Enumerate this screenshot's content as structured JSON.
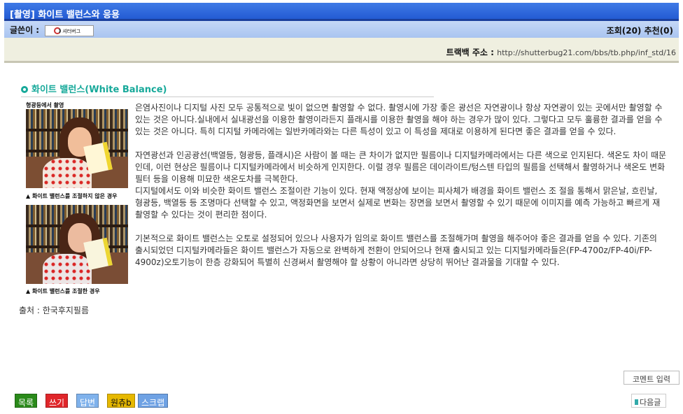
{
  "header": {
    "title": "[촬영] 화이트 밸런스와 응용"
  },
  "author": {
    "label": "글쓴이 :",
    "logo_text": "셔터버그",
    "stats": "조회(20) 추천(0)"
  },
  "trackback": {
    "label": "트랙백 주소 : ",
    "url": "http://shutterbug21.com/bbs/tb.php/inf_std/16"
  },
  "article": {
    "heading": "화이트 밸런스(White Balance)",
    "images": [
      {
        "top_caption": "형광등에서 촬영",
        "caption": "▲ 화이트 밸런스를 조절하지 않은 경우"
      },
      {
        "caption": "▲ 화이트 밸런스를 조절한 경우"
      }
    ],
    "paragraphs": [
      "은염사진이나 디지털 사진 모두 공통적으로 빛이 없으면 촬영할 수 없다. 촬영시에 가장 좋은 광선은 자연광이나 항상 자연광이 있는 곳에서만 촬영할 수 있는 것은 아니다.실내에서 실내광선을 이용한 촬영이라든지 플래시를 이용한 촬영을 해야 하는 경우가 많이 있다. 그렇다고 모두 훌륭한 결과를 얻을 수 있는 것은 아니다. 특히 디지털 카메라에는 일반카메라와는 다른 특성이 있고 이 특성을 제대로 이용하게 된다면 좋은 결과를 얻을 수 있다.",
      "자연광선과 인공광선(백열등, 형광등, 플래시)은 사람이 볼 때는 큰 차이가 없지만 필름이나 디지털카메라에서는 다른 색으로 인지된다. 색온도 차이 때문인데, 이런 현상은 필름이나 디지털카메라에서 비슷하게 인지한다. 이럴 경우 필름은 데이라이트/텅스텐 타입의 필름을 선택해서 촬영하거나 색온도 변화 필터 등을 이용해 미묘한 색온도차를 극복한다.",
      "디지털에서도 이와 비슷한 화이트 밸런스 조절이란 기능이 있다. 현재 액정상에 보이는 피사체가 배경을 화이트 밸런스 조 절을 통해서 맑은날, 흐린날, 형광등, 백열등 등 조명마다 선택할 수 있고, 액정화면을 보면서 실제로 변화는 장면을 보면서 촬영할 수 있기 때문에 이미지를 예측 가능하고 빠르게 재촬영할 수 있다는 것이 편리한 점이다.",
      "기본적으로 화이트 밸런스는 오토로 설정되어 있으나 사용자가 임의로 화이트 밸런스를 조절해가며 촬영을 해주어야 좋은 결과를 얻을 수 있다. 기존의 출시되었던 디지털카메라들은 화이트 밸런스가 자동으로 완벽하게 전환이 안되어으나 현재 출시되고 있는 디지털카메라들은(FP-4700z/FP-40i/FP-4900z)오토기능이 한층 강화되어 특별히 신경써서 촬영해야 할 상황이 아니라면 상당히 뛰어난 결과물을 기대할 수 있다."
    ],
    "source": "출처 : 한국후지필름"
  },
  "buttons": {
    "list": "목록",
    "write": "쓰기",
    "reply": "답변",
    "original": "원츄b",
    "scrap": "스크랩",
    "comment": "코멘트 입력",
    "next": "다음글"
  },
  "colors": {
    "list": "#2a8a1a",
    "write": "#e0262a",
    "reply": "#7fb2ec",
    "original": "#e6b800",
    "scrap": "#6fa2e4"
  }
}
